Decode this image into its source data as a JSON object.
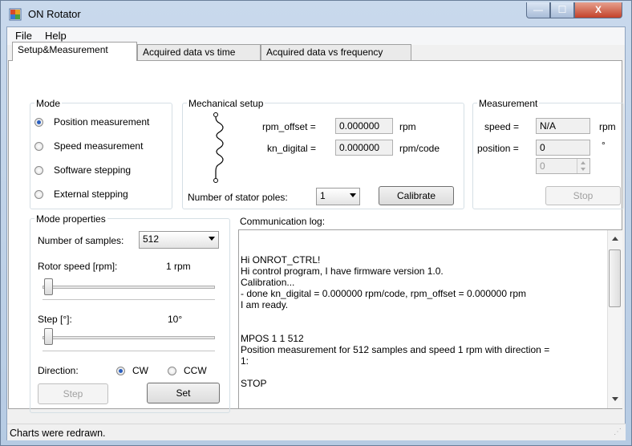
{
  "window": {
    "title": "ON Rotator",
    "minimize": "—",
    "maximize": "☐",
    "close": "X"
  },
  "menu": {
    "file": "File",
    "help": "Help"
  },
  "tabs": [
    "Setup&Measurement",
    "Acquired data vs time",
    "Acquired data vs frequency"
  ],
  "mode": {
    "title": "Mode",
    "options": [
      "Position measurement",
      "Speed measurement",
      "Software stepping",
      "External stepping"
    ],
    "selected_index": 0
  },
  "mechanical": {
    "title": "Mechanical setup",
    "rpm_offset_label": "rpm_offset =",
    "rpm_offset_value": "0.000000",
    "rpm_offset_unit": "rpm",
    "kn_digital_label": "kn_digital =",
    "kn_digital_value": "0.000000",
    "kn_digital_unit": "rpm/code",
    "poles_label": "Number of stator poles:",
    "poles_value": "1",
    "calibrate_label": "Calibrate"
  },
  "measurement": {
    "title": "Measurement",
    "speed_label": "speed =",
    "speed_value": "N/A",
    "speed_unit": "rpm",
    "position_label": "position =",
    "position_value": "0",
    "position_unit": "°",
    "spinner_value": "0",
    "stop_label": "Stop"
  },
  "mode_props": {
    "title": "Mode properties",
    "samples_label": "Number of samples:",
    "samples_value": "512",
    "rotor_speed_label": "Rotor speed [rpm]:",
    "rotor_speed_value": "1 rpm",
    "step_label": "Step [°]:",
    "step_value": "10°",
    "direction_label": "Direction:",
    "cw_label": "CW",
    "ccw_label": "CCW",
    "step_button": "Step",
    "set_button": "Set"
  },
  "log": {
    "title": "Communication log:",
    "lines": [
      "Hi ONROT_CTRL!",
      "Hi control program, I have firmware version 1.0.",
      "Calibration...",
      "- done kn_digital = 0.000000 rpm/code, rpm_offset = 0.000000 rpm",
      "I am ready.",
      "",
      "",
      "MPOS 1 1 512",
      "Position measurement for 512 samples and speed 1 rpm with direction =",
      "1:",
      "",
      "STOP"
    ]
  },
  "status": {
    "text": "Charts were redrawn."
  },
  "colors": {
    "accent": "#2a5fbf",
    "close": "#c3422a",
    "frame": "#b6cbe3"
  }
}
